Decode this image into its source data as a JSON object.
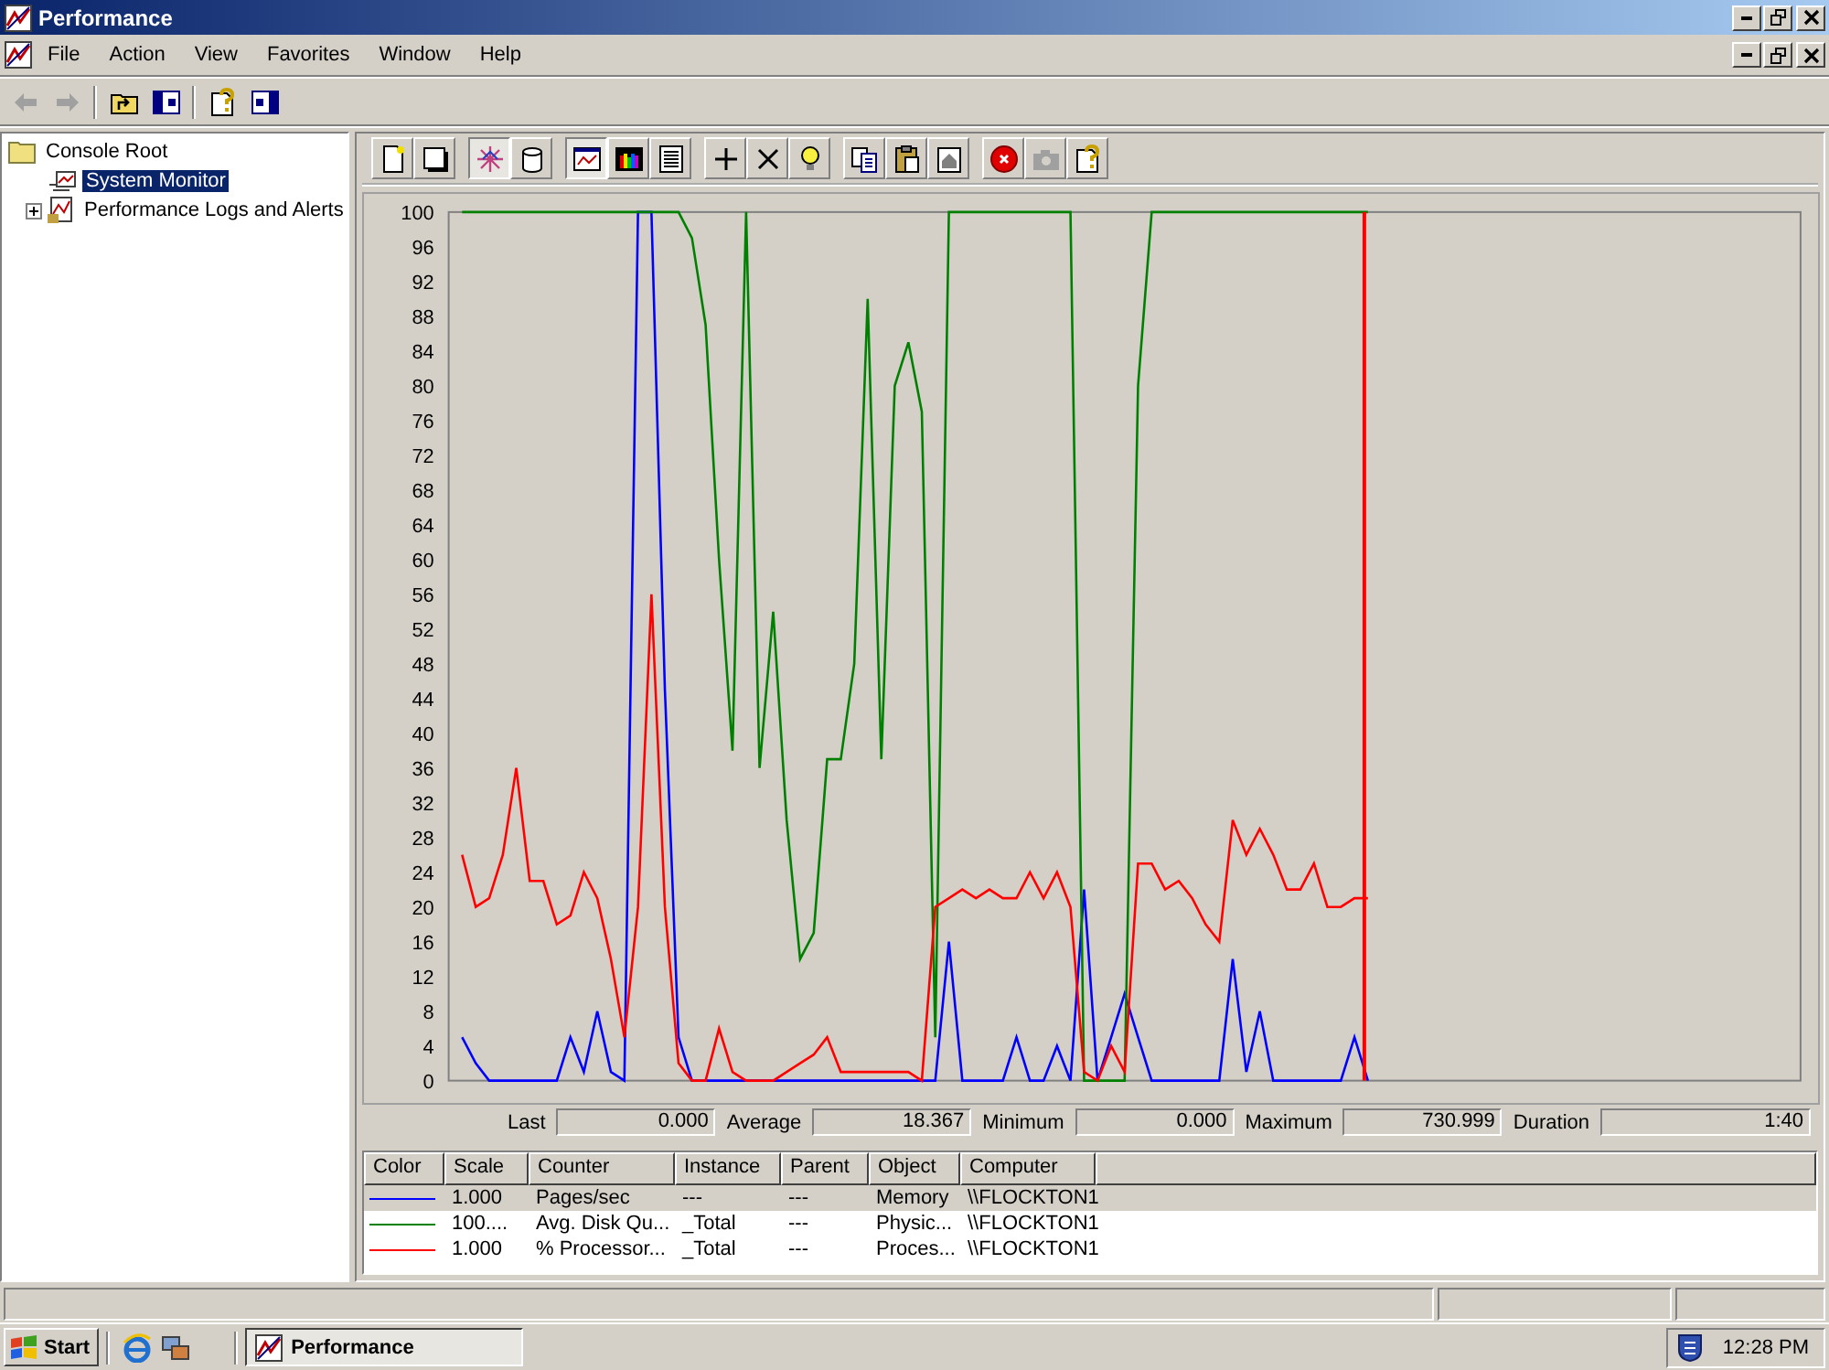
{
  "window": {
    "title": "Performance"
  },
  "menu": [
    "File",
    "Action",
    "View",
    "Favorites",
    "Window",
    "Help"
  ],
  "nav_toolbar": [
    {
      "kind": "back",
      "disabled": true
    },
    {
      "kind": "forward",
      "disabled": true
    },
    {
      "kind": "up",
      "disabled": false
    },
    {
      "kind": "tree",
      "disabled": false
    },
    {
      "kind": "help",
      "disabled": false
    },
    {
      "kind": "pane",
      "disabled": false
    }
  ],
  "tree": [
    {
      "label": "Console Root",
      "selected": false,
      "children": [
        {
          "label": "System Monitor",
          "selected": true
        },
        {
          "label": "Performance Logs and Alerts",
          "selected": false,
          "expanded": false
        }
      ]
    }
  ],
  "monitor_toolbar": [
    {
      "kind": "new",
      "pressed": false,
      "disabled": false
    },
    {
      "kind": "clear",
      "pressed": false,
      "disabled": false
    },
    {
      "kind": "current",
      "pressed": true,
      "disabled": false
    },
    {
      "kind": "log",
      "pressed": false,
      "disabled": false
    },
    {
      "kind": "graph",
      "pressed": true,
      "disabled": false
    },
    {
      "kind": "histogram",
      "pressed": false,
      "disabled": false
    },
    {
      "kind": "report",
      "pressed": false,
      "disabled": false
    },
    {
      "kind": "add",
      "pressed": false,
      "disabled": false
    },
    {
      "kind": "delete",
      "pressed": false,
      "disabled": false
    },
    {
      "kind": "highlight",
      "pressed": false,
      "disabled": false
    },
    {
      "kind": "copy",
      "pressed": false,
      "disabled": false
    },
    {
      "kind": "paste",
      "pressed": false,
      "disabled": false
    },
    {
      "kind": "properties",
      "pressed": false,
      "disabled": false
    },
    {
      "kind": "freeze",
      "pressed": false,
      "disabled": false
    },
    {
      "kind": "update",
      "pressed": false,
      "disabled": true
    },
    {
      "kind": "help",
      "pressed": false,
      "disabled": false
    }
  ],
  "chart_data": {
    "type": "line",
    "ylim": [
      0,
      100
    ],
    "yticks": [
      0,
      4,
      8,
      12,
      16,
      20,
      24,
      28,
      32,
      36,
      40,
      44,
      48,
      52,
      56,
      60,
      64,
      68,
      72,
      76,
      80,
      84,
      88,
      92,
      96,
      100
    ],
    "series": [
      {
        "color": "#0000ff",
        "values": [
          5,
          2,
          0,
          0,
          0,
          0,
          0,
          0,
          5,
          1,
          8,
          1,
          0,
          100,
          100,
          45,
          5,
          0,
          0,
          0,
          0,
          0,
          0,
          0,
          0,
          0,
          0,
          0,
          0,
          0,
          0,
          0,
          0,
          0,
          0,
          0,
          16,
          0,
          0,
          0,
          0,
          5,
          0,
          0,
          4,
          0,
          22,
          0,
          5,
          10,
          5,
          0,
          0,
          0,
          0,
          0,
          0,
          14,
          1,
          8,
          0,
          0,
          0,
          0,
          0,
          0,
          5,
          0
        ]
      },
      {
        "color": "#008000",
        "values": [
          100,
          100,
          100,
          100,
          100,
          100,
          100,
          100,
          100,
          100,
          100,
          100,
          100,
          100,
          100,
          100,
          100,
          97,
          87,
          60,
          38,
          100,
          36,
          54,
          30,
          14,
          17,
          37,
          37,
          48,
          90,
          37,
          80,
          85,
          77,
          5,
          100,
          100,
          100,
          100,
          100,
          100,
          100,
          100,
          100,
          100,
          0,
          0,
          0,
          0,
          80,
          100,
          100,
          100,
          100,
          100,
          100,
          100,
          100,
          100,
          100,
          100,
          100,
          100,
          100,
          100,
          100,
          100
        ]
      },
      {
        "color": "#ff0000",
        "values": [
          26,
          20,
          21,
          26,
          36,
          23,
          23,
          18,
          19,
          24,
          21,
          14,
          5,
          20,
          56,
          20,
          2,
          0,
          0,
          6,
          1,
          0,
          0,
          0,
          1,
          2,
          3,
          5,
          1,
          1,
          1,
          1,
          1,
          1,
          0,
          20,
          21,
          22,
          21,
          22,
          21,
          21,
          24,
          21,
          24,
          20,
          1,
          0,
          4,
          1,
          25,
          25,
          22,
          23,
          21,
          18,
          16,
          30,
          26,
          29,
          26,
          22,
          22,
          25,
          20,
          20,
          21,
          21
        ]
      }
    ]
  },
  "values": [
    {
      "label": "Last",
      "value": "0.000"
    },
    {
      "label": "Average",
      "value": "18.367"
    },
    {
      "label": "Minimum",
      "value": "0.000"
    },
    {
      "label": "Maximum",
      "value": "730.999"
    },
    {
      "label": "Duration",
      "value": "1:40"
    }
  ],
  "legend": {
    "columns": [
      "Color",
      "Scale",
      "Counter",
      "Instance",
      "Parent",
      "Object",
      "Computer"
    ],
    "rows": [
      {
        "color": "#0000ff",
        "scale": "1.000",
        "counter": "Pages/sec",
        "instance": "---",
        "parent": "---",
        "object": "Memory",
        "computer": "\\\\FLOCKTON1",
        "selected": true
      },
      {
        "color": "#008000",
        "scale": "100....",
        "counter": "Avg. Disk Qu...",
        "instance": "_Total",
        "parent": "---",
        "object": "Physic...",
        "computer": "\\\\FLOCKTON1",
        "selected": false
      },
      {
        "color": "#ff0000",
        "scale": "1.000",
        "counter": "% Processor...",
        "instance": "_Total",
        "parent": "---",
        "object": "Proces...",
        "computer": "\\\\FLOCKTON1",
        "selected": false
      }
    ]
  },
  "taskbar": {
    "start": "Start",
    "tasks": [
      {
        "label": "Performance",
        "selected": true
      }
    ],
    "clock": "12:28 PM"
  }
}
